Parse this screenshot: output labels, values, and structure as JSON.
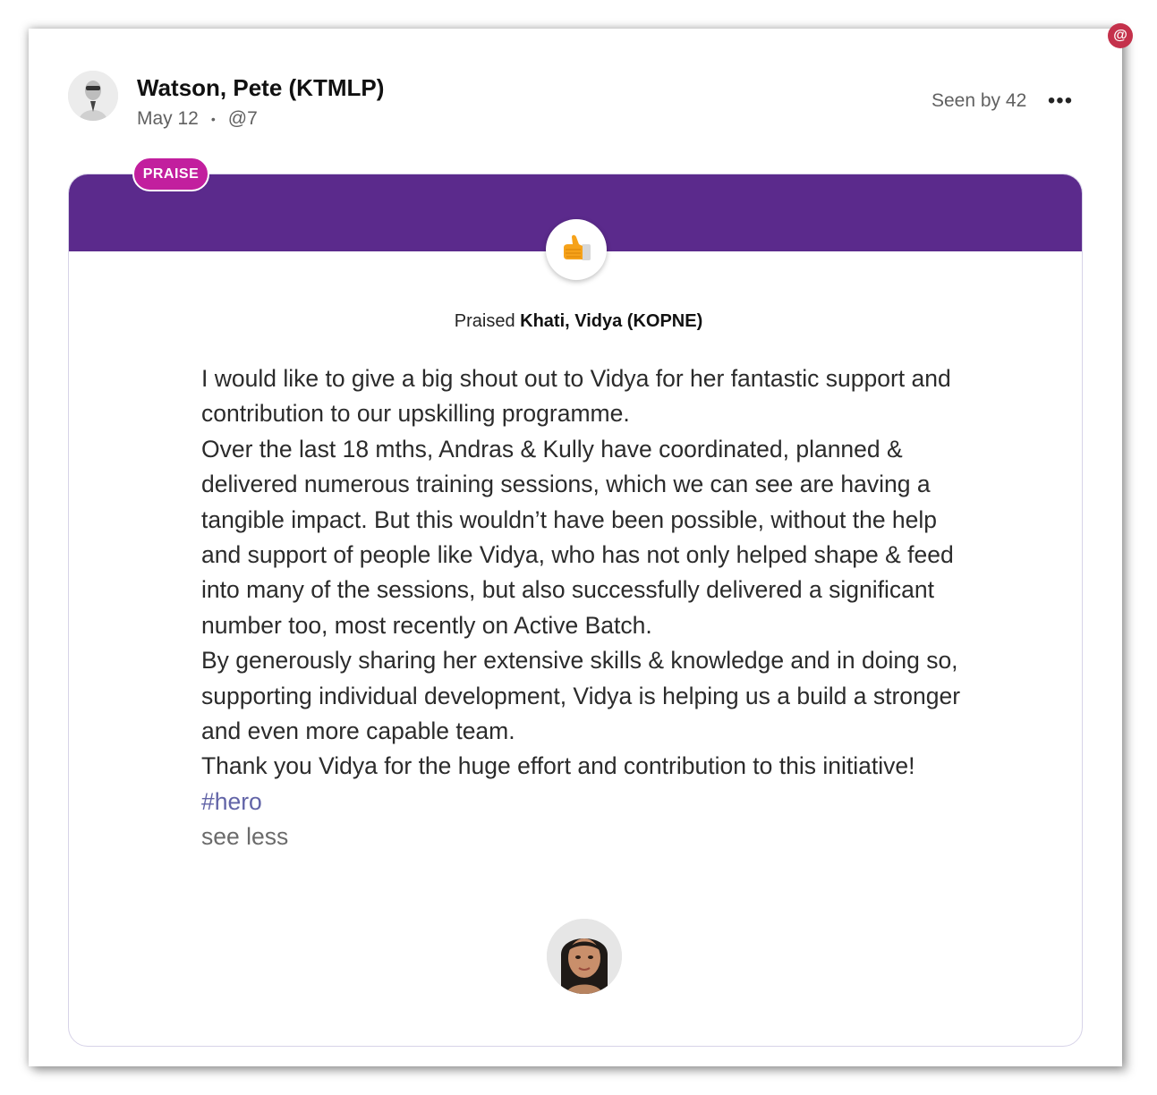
{
  "post": {
    "author_name": "Watson, Pete (KTMLP)",
    "date": "May 12",
    "separator": "•",
    "mention_count": "@7",
    "seen_by": "Seen by 42",
    "more_label": "•••",
    "corner_badge": "@"
  },
  "praise": {
    "tag": "PRAISE",
    "banner_color": "#5b2a8c",
    "tag_color": "#c21f9e",
    "badge_icon": "thumbs-up-icon",
    "praised_prefix": "Praised",
    "recipient_name": "Khati, Vidya (KOPNE)",
    "message_paragraphs": [
      "I would like to give a big shout out to Vidya for her fantastic support and contribution to our upskilling programme.",
      "Over the last 18 mths, Andras & Kully have coordinated, planned & delivered numerous training sessions, which we can see are having a tangible impact. But this wouldn’t have been possible, without the help and support of people like Vidya, who has not only helped shape & feed into many of the sessions, but also successfully delivered a significant number too, most recently on Active Batch.",
      "By generously sharing her extensive skills & knowledge and in doing so, supporting individual development, Vidya is helping us a build a stronger and even more capable team.",
      "Thank you Vidya for the huge effort and contribution to this initiative!"
    ],
    "hashtag": "#hero",
    "see_less": "see less"
  }
}
